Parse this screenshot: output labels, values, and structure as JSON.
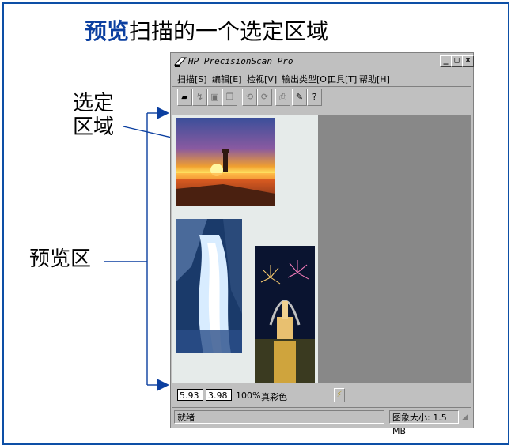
{
  "slide": {
    "heading_highlight": "预览",
    "heading_rest": "扫描的一个选定区域",
    "callout_selected_line1": "选定",
    "callout_selected_line2": "区域",
    "callout_preview": "预览区"
  },
  "window": {
    "title": "HP PrecisionScan Pro",
    "controls": {
      "minimize": "_",
      "maximize": "□",
      "close": "×"
    },
    "menu": [
      "扫描[S]",
      "编辑[E]",
      "检视[V]",
      "输出类型[O]",
      "工具[T]",
      "帮助[H]"
    ],
    "toolbar_icons": [
      "scan-icon",
      "rescan-icon",
      "save-icon",
      "copy-icon",
      "rotate-left-icon",
      "rotate-right-icon",
      "print-icon",
      "settings-icon",
      "help-icon"
    ]
  },
  "status": {
    "width_value": "5.93",
    "height_value": "3.98",
    "zoom": "100%",
    "color_mode": "真彩色",
    "state": "就绪",
    "image_size": "图象大小: 1.5 MB"
  },
  "colors": {
    "border": "#0d4fa6",
    "arrow": "#0b3fa0",
    "preview_bg": "#888888"
  }
}
